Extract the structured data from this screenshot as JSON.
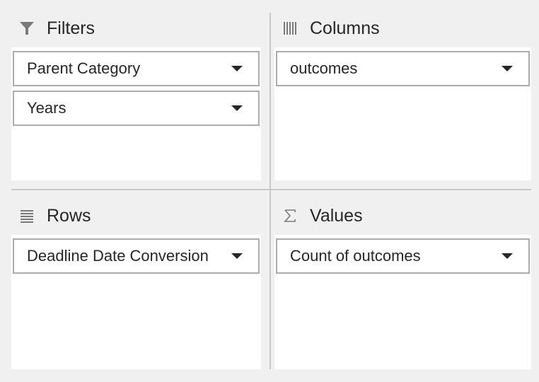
{
  "filters": {
    "title": "Filters",
    "icon": "filter-icon",
    "fields": [
      {
        "label": "Parent Category"
      },
      {
        "label": "Years"
      }
    ]
  },
  "columns": {
    "title": "Columns",
    "icon": "columns-icon",
    "fields": [
      {
        "label": "outcomes"
      }
    ]
  },
  "rows": {
    "title": "Rows",
    "icon": "rows-icon",
    "fields": [
      {
        "label": "Deadline Date Conversion"
      }
    ]
  },
  "values": {
    "title": "Values",
    "icon": "sigma-icon",
    "fields": [
      {
        "label": "Count of outcomes"
      }
    ]
  },
  "colors": {
    "background": "#f0f0f0",
    "panel": "#ffffff",
    "border": "#acacac",
    "divider": "#c8c8c8",
    "icon": "#7a7a7a",
    "text": "#262626"
  }
}
